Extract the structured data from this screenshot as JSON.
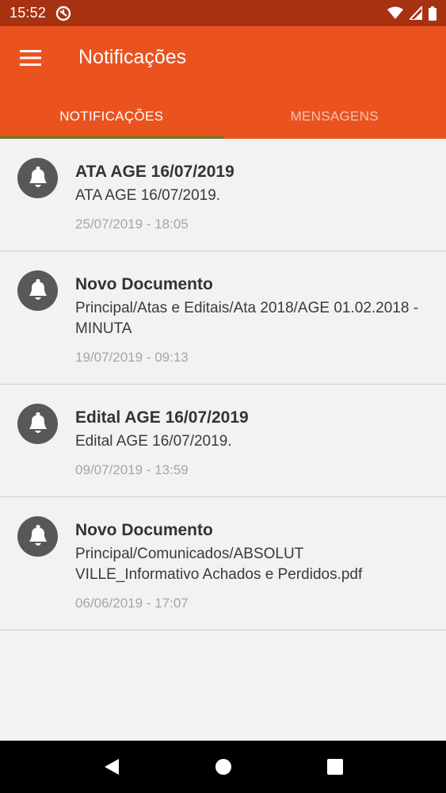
{
  "status_bar": {
    "time": "15:52"
  },
  "app_bar": {
    "title": "Notificações"
  },
  "tabs": [
    {
      "label": "NOTIFICAÇÕES",
      "active": true
    },
    {
      "label": "MENSAGENS",
      "active": false
    }
  ],
  "notifications": [
    {
      "title": "ATA AGE 16/07/2019",
      "body": "ATA AGE 16/07/2019.",
      "date": "25/07/2019 - 18:05"
    },
    {
      "title": "Novo Documento",
      "body": "Principal/Atas e Editais/Ata 2018/AGE 01.02.2018 - MINUTA",
      "date": "19/07/2019 - 09:13"
    },
    {
      "title": "Edital AGE 16/07/2019",
      "body": "Edital AGE 16/07/2019.",
      "date": "09/07/2019 - 13:59"
    },
    {
      "title": "Novo Documento",
      "body": "Principal/Comunicados/ABSOLUT VILLE_Informativo Achados e Perdidos.pdf",
      "date": "06/06/2019 - 17:07"
    }
  ],
  "colors": {
    "status_bar": "#a63212",
    "app_bar": "#ea531f",
    "tab_indicator": "#5a7a24",
    "bell_circle": "#58585a"
  },
  "icons": {
    "menu": "hamburger-icon",
    "notification": "bell-icon",
    "nav_back": "back-triangle-icon",
    "nav_home": "home-circle-icon",
    "nav_recents": "recents-square-icon"
  }
}
